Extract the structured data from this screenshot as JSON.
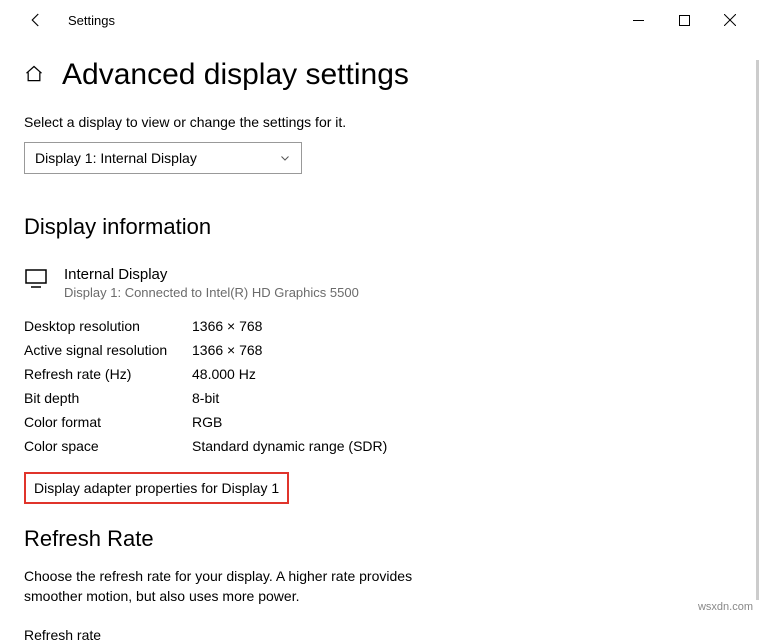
{
  "titlebar": {
    "app_name": "Settings"
  },
  "header": {
    "title": "Advanced display settings"
  },
  "instruction": "Select a display to view or change the settings for it.",
  "display_selector": {
    "selected": "Display 1: Internal Display"
  },
  "display_info": {
    "section_title": "Display information",
    "name": "Internal Display",
    "subtitle": "Display 1: Connected to Intel(R) HD Graphics 5500",
    "properties": [
      {
        "label": "Desktop resolution",
        "value": "1366 × 768"
      },
      {
        "label": "Active signal resolution",
        "value": "1366 × 768"
      },
      {
        "label": "Refresh rate (Hz)",
        "value": "48.000 Hz"
      },
      {
        "label": "Bit depth",
        "value": "8-bit"
      },
      {
        "label": "Color format",
        "value": "RGB"
      },
      {
        "label": "Color space",
        "value": "Standard dynamic range (SDR)"
      }
    ],
    "adapter_link": "Display adapter properties for Display 1"
  },
  "refresh_rate": {
    "section_title": "Refresh Rate",
    "description": "Choose the refresh rate for your display. A higher rate provides smoother motion, but also uses more power.",
    "label": "Refresh rate"
  },
  "watermark": "wsxdn.com"
}
